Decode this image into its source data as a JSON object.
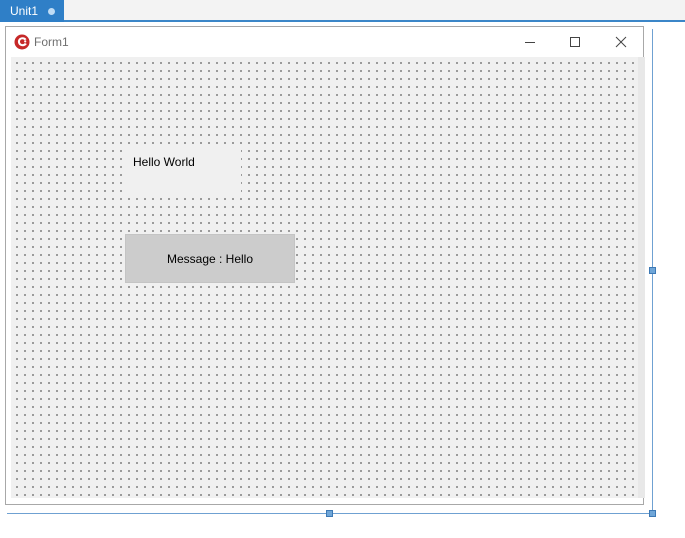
{
  "editor": {
    "active_tab": "Unit1"
  },
  "form": {
    "title": "Form1",
    "icons": {
      "app": "lazarus-app-icon",
      "minimize": "minimize-icon",
      "maximize": "maximize-icon",
      "close": "close-icon"
    },
    "label_text": "Hello World",
    "button_caption": "Message : Hello"
  },
  "colors": {
    "tab_accent": "#2f7fc7",
    "form_background": "#f0f0f0",
    "button_background": "#cccccc",
    "guide_line": "#6fa1d2"
  }
}
